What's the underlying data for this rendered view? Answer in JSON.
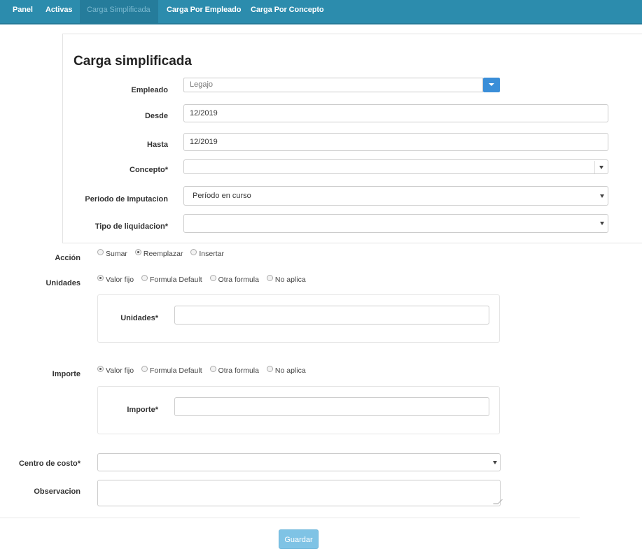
{
  "nav": {
    "items": [
      {
        "label": "Panel"
      },
      {
        "label": "Activas"
      },
      {
        "label": "Carga Simplificada"
      },
      {
        "label": "Carga Por Empleado"
      },
      {
        "label": "Carga Por Concepto"
      }
    ],
    "active_index": 2
  },
  "form": {
    "title": "Carga simplificada",
    "empleado": {
      "label": "Empleado",
      "placeholder": "Legajo"
    },
    "desde": {
      "label": "Desde",
      "value": "12/2019"
    },
    "hasta": {
      "label": "Hasta",
      "value": "12/2019"
    },
    "concepto": {
      "label": "Concepto*",
      "value": ""
    },
    "periodo": {
      "label": "Periodo de Imputacion",
      "value": "Período en curso"
    },
    "tipo": {
      "label": "Tipo de liquidacion*",
      "value": ""
    },
    "accion": {
      "label": "Acción",
      "options": [
        {
          "label": "Sumar",
          "checked": false
        },
        {
          "label": "Reemplazar",
          "checked": true
        },
        {
          "label": "Insertar",
          "checked": false
        }
      ]
    },
    "unidades": {
      "label": "Unidades",
      "options": [
        {
          "label": "Valor fijo",
          "checked": true
        },
        {
          "label": "Formula Default",
          "checked": false
        },
        {
          "label": "Otra formula",
          "checked": false
        },
        {
          "label": "No aplica",
          "checked": false
        }
      ],
      "sub_label": "Unidades*",
      "value": ""
    },
    "importe": {
      "label": "Importe",
      "options": [
        {
          "label": "Valor fijo",
          "checked": true
        },
        {
          "label": "Formula Default",
          "checked": false
        },
        {
          "label": "Otra formula",
          "checked": false
        },
        {
          "label": "No aplica",
          "checked": false
        }
      ],
      "sub_label": "Importe*",
      "value": ""
    },
    "centro": {
      "label": "Centro de costo*",
      "value": ""
    },
    "observacion": {
      "label": "Observacion",
      "value": ""
    },
    "save_label": "Guardar"
  },
  "colors": {
    "navbar": "#2c8cad",
    "accent_button": "#3a8ed8",
    "save_button": "#7fc3e5"
  }
}
